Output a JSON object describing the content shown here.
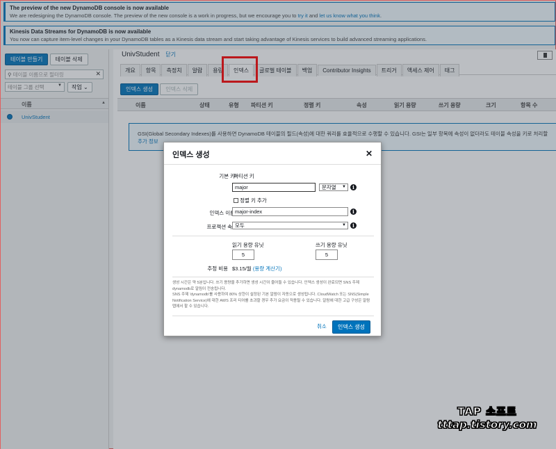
{
  "banners": [
    {
      "title": "The preview of the new DynamoDB console is now available",
      "desc_before": "We are redesigning the DynamoDB console. The preview of the new console is a work in progress, but we encourage you to",
      "link1": "try it",
      "and": "and",
      "link2": "let us know what you think",
      "desc_after": "."
    },
    {
      "title": "Kinesis Data Streams for DynamoDB is now available",
      "desc": "You now can capture item-level changes in your DynamoDB tables as a Kinesis data stream and start taking advantage of Kinesis services to build advanced streaming applications."
    }
  ],
  "left_panel": {
    "create_table": "테이블 만들기",
    "delete_table": "테이블 삭제",
    "filter_placeholder": "테이블 이름으로 필터링",
    "group_select": "테이블 그룹 선택",
    "actions": "작업",
    "column_name": "이름",
    "tables": [
      "UnivStudent"
    ]
  },
  "main": {
    "table_name": "UnivStudent",
    "close": "닫기",
    "tabs": [
      "개요",
      "항목",
      "측정치",
      "알람",
      "용량",
      "인덱스",
      "글로벌 테이블",
      "백업",
      "Contributor Insights",
      "트리거",
      "액세스 제어",
      "태그"
    ],
    "active_tab": "인덱스",
    "create_index": "인덱스 생성",
    "delete_index": "인덱스 삭제",
    "columns": [
      "이름",
      "상태",
      "유형",
      "파티션 키",
      "정렬 키",
      "속성",
      "읽기 용량",
      "쓰기 용량",
      "크기",
      "항목 수"
    ],
    "gsi_info": "GSI(Global Secondary Indexes)를 사용하면 DynamoDB 테이블의 필드(속성)에 대한 쿼리를 효율적으로 수행할 수 있습니다. GSI는 일부 항목에 속성이 없더라도 테이블 속성을 키로 처리할",
    "gsi_more": "추가 정보"
  },
  "modal": {
    "title": "인덱스 생성",
    "primary_key_label": "기본 키*",
    "partition_key_label": "파티션 키",
    "partition_key_value": "major",
    "key_type": "문자열",
    "add_sort_key": "정렬 키 추가",
    "index_name_label": "인덱스 이름*",
    "index_name_value": "major-index",
    "projection_label": "프로젝션 속성",
    "projection_value": "모두",
    "read_capacity_label": "읽기 용량 유닛",
    "read_capacity_value": "5",
    "write_capacity_label": "쓰기 용량 유닛",
    "write_capacity_value": "5",
    "estimated_cost_label": "추정 비용",
    "estimated_cost_value": "$3.15/월",
    "capacity_calc_link": "(용량 계산기)",
    "note1": "생성 시간은 약 5분입니다. 쓰기 용량을 추가하면 생성 시간이 줄어들 수 있습니다. 인덱스 생성이 완료되면 SNS 주제 dynamodb로 알림이 전송됩니다.",
    "note2": "SNS 주제 'dynamodb'를 사용하여 80% 상한이 설정된 기본 알람이 자동으로 생성됩니다. CloudWatch 또는 SNS(Simple Notification Service)에 대한 AWS 프리 티어를 초과할 경우 추가 요금이 적용될 수 있습니다. 알람에 대한 고급 구성은 알람 탭에서 할 수 있습니다.",
    "cancel": "취소",
    "submit": "인덱스 생성"
  },
  "watermark": {
    "line1": "TAP 소프트",
    "line2": "tttap.tistory.com"
  },
  "colors": {
    "primary": "#0073bb",
    "highlight": "#ff0000"
  }
}
